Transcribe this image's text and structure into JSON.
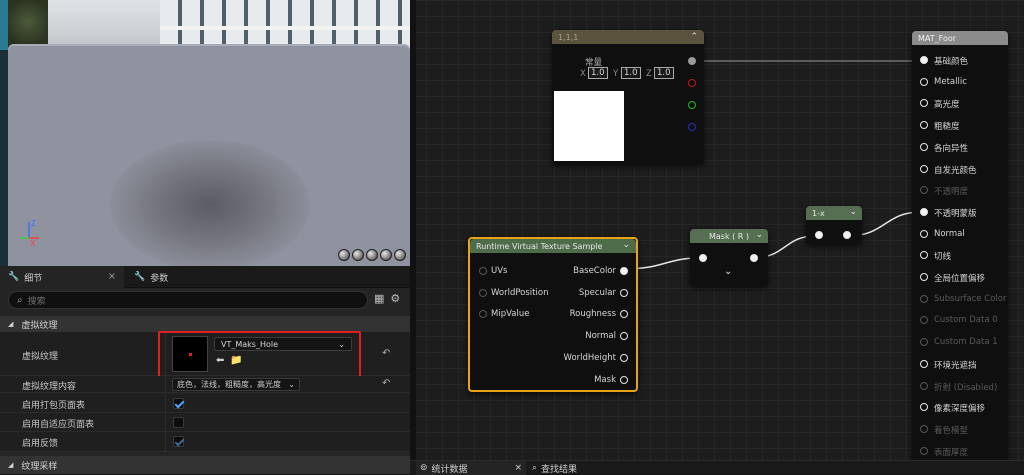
{
  "viewport": {
    "axis_z": "Z",
    "axis_x": "X",
    "axis_y": "Y",
    "preview_spheres": [
      "sphere-preview-1",
      "sphere-preview-2",
      "sphere-preview-3",
      "sphere-preview-4",
      "sphere-preview-5"
    ]
  },
  "details_panel": {
    "tabs": [
      {
        "label": "细节",
        "icon": "wrench-icon",
        "close": "×"
      },
      {
        "label": "参数",
        "icon": "wrench-icon"
      }
    ],
    "search_placeholder": "搜索",
    "categories": {
      "virtual_texture": "虚拟纹理",
      "texture_sampling": "纹理采样"
    },
    "rows": {
      "virtual_texture_label": "虚拟纹理",
      "virtual_texture_value": "VT_Maks_Hole",
      "virtual_texture_content_label": "虚拟纹理内容",
      "virtual_texture_content_value": "底色，法线，粗糙度，高光度",
      "enable_packed_page_table_label": "启用打包页面表",
      "enable_packed_page_table": true,
      "enable_adaptive_page_table_label": "启用自适应页面表",
      "enable_adaptive_page_table": false,
      "enable_feedback_label": "启用反馈",
      "enable_feedback": true
    },
    "reset_glyph": "↶",
    "dropdown_glyph": "⌄"
  },
  "graph": {
    "constant_node": {
      "title": "1,1,1",
      "label": "常量",
      "x_label": "X",
      "x_value": "1.0",
      "y_label": "Y",
      "y_value": "1.0",
      "z_label": "Z",
      "z_value": "1.0"
    },
    "rvt_node": {
      "title": "Runtime Virtual Texture Sample",
      "inputs": [
        "UVs",
        "WorldPosition",
        "MipValue"
      ],
      "outputs": [
        "BaseColor",
        "Specular",
        "Roughness",
        "Normal",
        "WorldHeight",
        "Mask"
      ]
    },
    "mask_node": {
      "title": "Mask ( R )"
    },
    "oneminus_node": {
      "title": "1-x"
    },
    "material_node": {
      "title": "MAT_Foor",
      "pins": [
        {
          "label": "基础颜色",
          "filled": true,
          "enabled": true
        },
        {
          "label": "Metallic",
          "filled": false,
          "enabled": true
        },
        {
          "label": "高光度",
          "filled": false,
          "enabled": true
        },
        {
          "label": "粗糙度",
          "filled": false,
          "enabled": true
        },
        {
          "label": "各向异性",
          "filled": false,
          "enabled": true
        },
        {
          "label": "自发光颜色",
          "filled": false,
          "enabled": true
        },
        {
          "label": "不透明度",
          "filled": false,
          "enabled": false
        },
        {
          "label": "不透明蒙版",
          "filled": true,
          "enabled": true
        },
        {
          "label": "Normal",
          "filled": false,
          "enabled": true
        },
        {
          "label": "切线",
          "filled": false,
          "enabled": true
        },
        {
          "label": "全局位置偏移",
          "filled": false,
          "enabled": true
        },
        {
          "label": "Subsurface Color",
          "filled": false,
          "enabled": false
        },
        {
          "label": "Custom Data 0",
          "filled": false,
          "enabled": false
        },
        {
          "label": "Custom Data 1",
          "filled": false,
          "enabled": false
        },
        {
          "label": "环境光遮挡",
          "filled": false,
          "enabled": true
        },
        {
          "label": "折射 (Disabled)",
          "filled": false,
          "enabled": false
        },
        {
          "label": "像素深度偏移",
          "filled": false,
          "enabled": true
        },
        {
          "label": "着色模型",
          "filled": false,
          "enabled": false
        },
        {
          "label": "表面厚度",
          "filled": false,
          "enabled": false
        }
      ]
    }
  },
  "bottom_tabs": [
    {
      "label": "统计数据",
      "close": "×"
    },
    {
      "label": "查找结果"
    }
  ],
  "colors": {
    "highlight_box": "#e02020",
    "rvt_border": "#e8a317",
    "rvt_header": "#4f6c4a",
    "constant_header": "#5c533f",
    "material_header": "#8b8b8b",
    "checkbox": "#4ea7ff"
  }
}
